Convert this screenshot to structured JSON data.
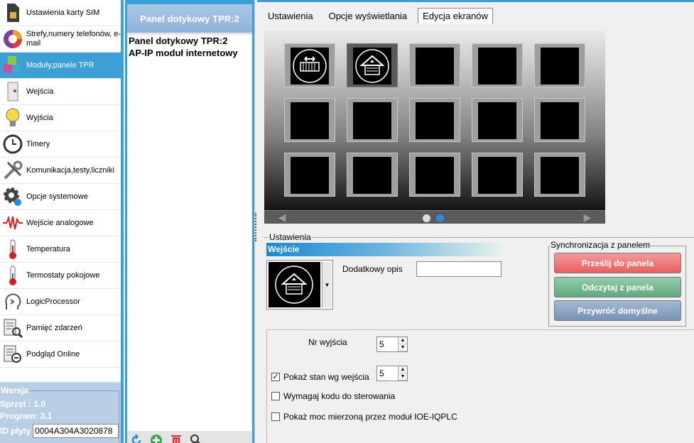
{
  "sidebar": {
    "items": [
      {
        "label": "Ustawienia karty SIM",
        "icon": "sim-card-icon"
      },
      {
        "label": "Strefy,numery telefonów, e-mail",
        "icon": "zones-pie-icon"
      },
      {
        "label": "Moduły,panele TPR",
        "icon": "modules-cubes-icon"
      },
      {
        "label": "Wejścia",
        "icon": "inputs-door-icon"
      },
      {
        "label": "Wyjścia",
        "icon": "outputs-bulb-icon"
      },
      {
        "label": "Timery",
        "icon": "clock-icon"
      },
      {
        "label": "Komunikacja,testy,liczniki",
        "icon": "tools-icon"
      },
      {
        "label": "Opcje systemowe",
        "icon": "gear-icon"
      },
      {
        "label": "Wejście analogowe",
        "icon": "waveform-icon"
      },
      {
        "label": "Temperatura",
        "icon": "thermometer-icon"
      },
      {
        "label": "Termostaty pokojowe",
        "icon": "thermostat-icon"
      },
      {
        "label": "LogicProcessor",
        "icon": "logic-head-icon"
      },
      {
        "label": "Pamięć zdarzeń",
        "icon": "event-log-icon"
      },
      {
        "label": "Podgląd Online",
        "icon": "online-preview-icon"
      }
    ]
  },
  "version": {
    "legend": "Wersja",
    "hardware": "Sprzęt : 1.0",
    "program": "Program: 3.1",
    "id_label": "ID płyty",
    "id_value": "0004A304A3020878"
  },
  "middle": {
    "header": "Panel dotykowy TPR:2",
    "devices": [
      "Panel dotykowy TPR:2",
      "AP-IP moduł internetowy"
    ]
  },
  "tabs": [
    "Ustawienia",
    "Opcje wyświetlania",
    "Edycja  ekranów"
  ],
  "screen": {
    "prev_glyph": "◀",
    "next_glyph": "▶",
    "pages": 2,
    "active_page": 2
  },
  "settings": {
    "legend": "Ustawienia",
    "section": "Wejście",
    "extra_label": "Dodatkowy opis",
    "extra_value": "",
    "output_label": "Nr wyjścia",
    "output_value": "5",
    "show_state_label": "Pokaż stan wg wejścia",
    "show_state_value": "5",
    "show_state_checked": true,
    "require_code_label": "Wymagaj kodu do sterowania",
    "require_code_checked": false,
    "show_power_label": "Pokaż moc mierzoną przez moduł IOE-IQPLC",
    "show_power_checked": false
  },
  "sync": {
    "legend": "Synchronizacja z panelem",
    "send": "Prześlij do panela",
    "read": "Odczytaj z panela",
    "restore": "Przywróć domyślne"
  },
  "colors": {
    "accent": "#3c9fd6",
    "send": "#e85f5f",
    "read": "#62a980",
    "restore": "#7592b5"
  }
}
